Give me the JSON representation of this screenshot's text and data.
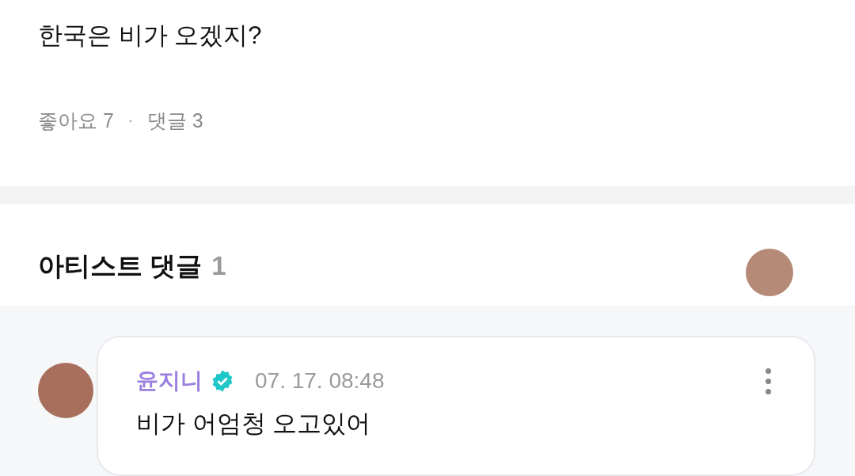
{
  "post": {
    "text": "한국은 비가 오겠지?",
    "likes_label": "좋아요",
    "likes": "7",
    "separator": "·",
    "comments_label": "댓글",
    "comments": "3"
  },
  "artist_comments": {
    "title": "아티스트 댓글",
    "count": "1",
    "comments": [
      {
        "author": "윤지니",
        "verified": true,
        "time": "07. 17. 08:48",
        "text": "비가 어엄청 오고있어"
      }
    ]
  }
}
